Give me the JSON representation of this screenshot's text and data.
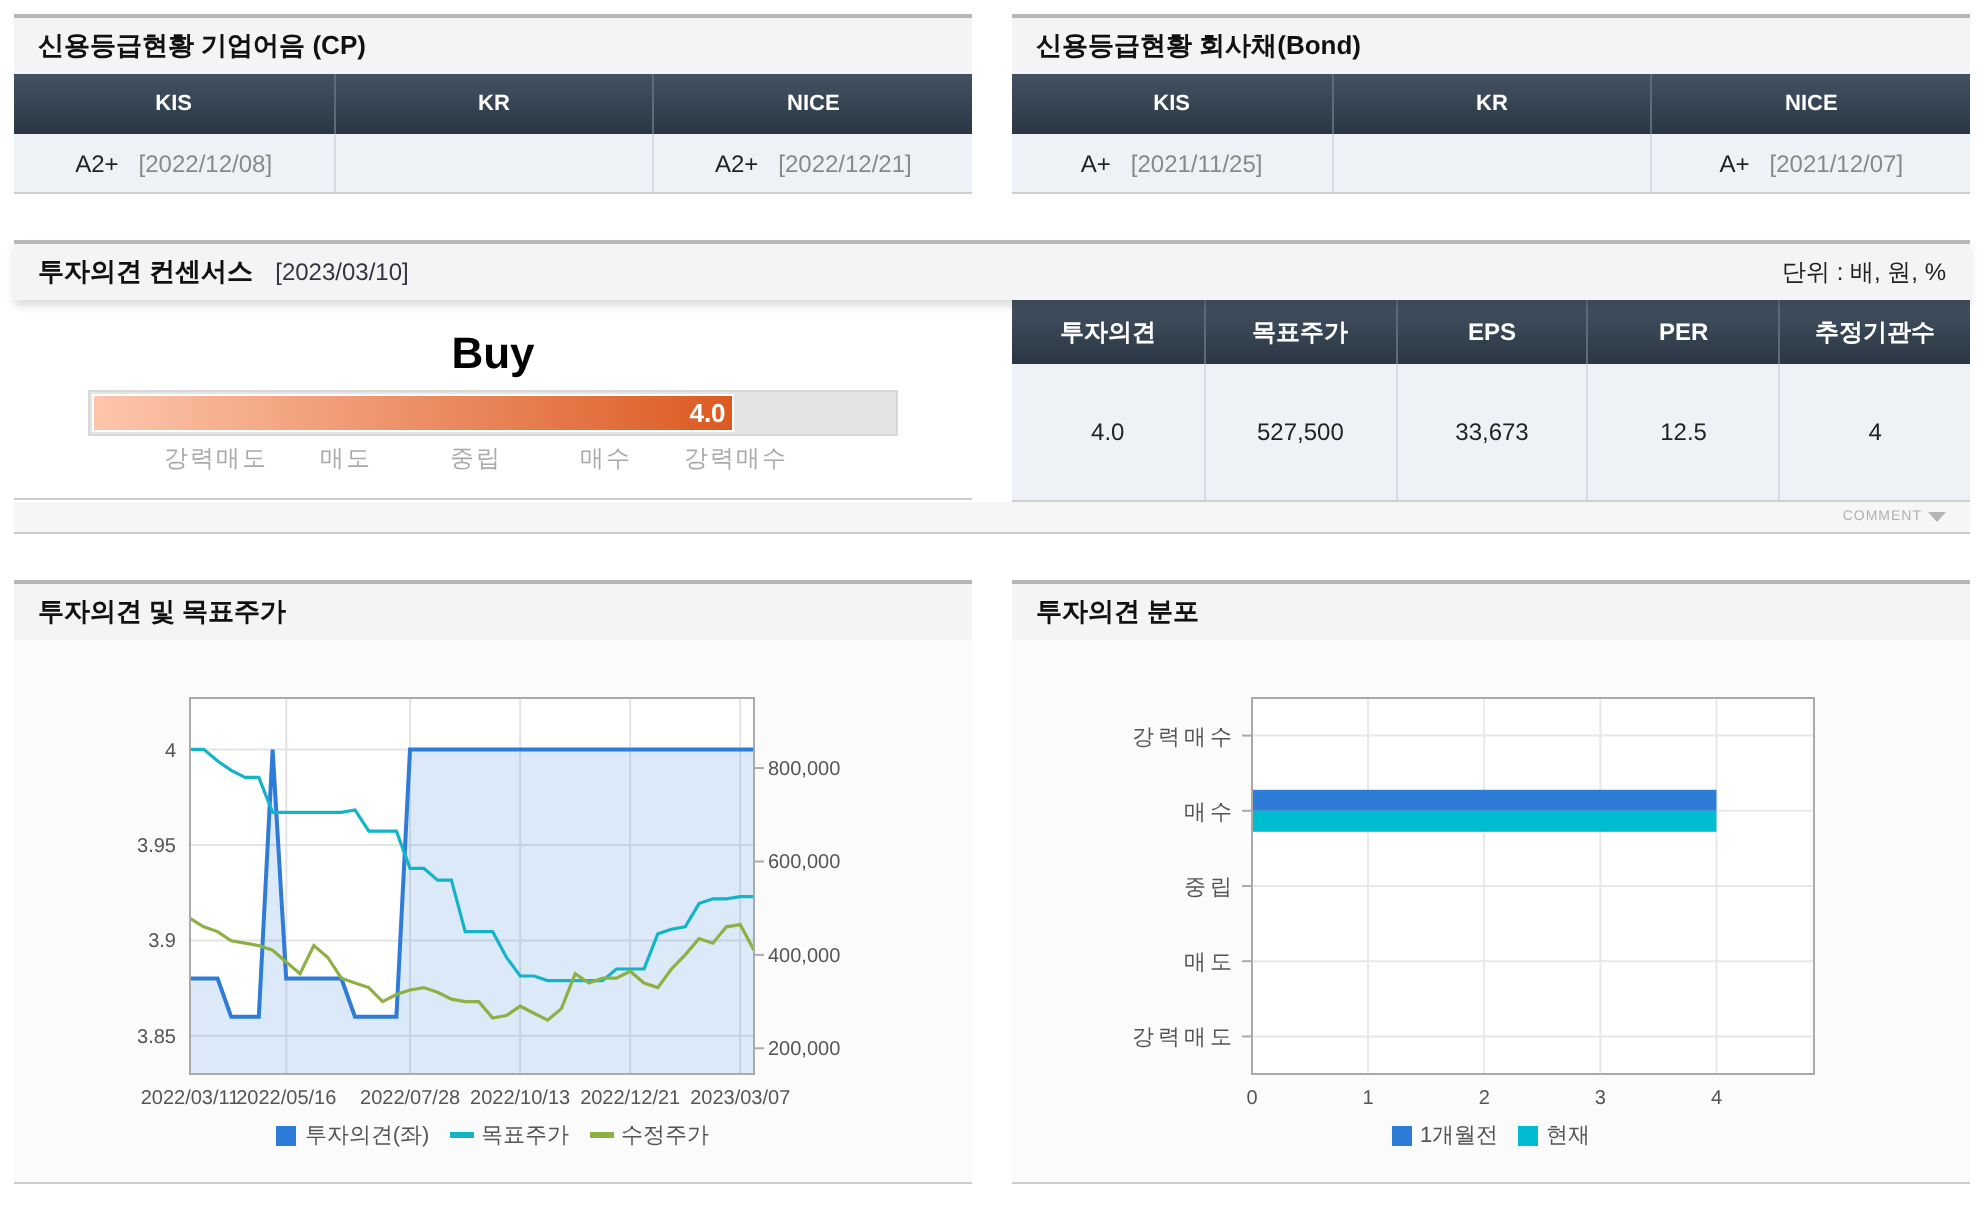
{
  "credit_ratings": [
    {
      "title": "신용등급현황 기업어음 (CP)",
      "columns": [
        "KIS",
        "KR",
        "NICE"
      ],
      "cells": [
        {
          "grade": "A2+",
          "date": "[2022/12/08]"
        },
        null,
        {
          "grade": "A2+",
          "date": "[2022/12/21]"
        }
      ]
    },
    {
      "title": "신용등급현황 회사채(Bond)",
      "columns": [
        "KIS",
        "KR",
        "NICE"
      ],
      "cells": [
        {
          "grade": "A+",
          "date": "[2021/11/25]"
        },
        null,
        {
          "grade": "A+",
          "date": "[2021/12/07]"
        }
      ]
    }
  ],
  "consensus": {
    "title": "투자의견 컨센서스",
    "date": "[2023/03/10]",
    "unit": "단위 : 배, 원, %",
    "gauge": {
      "label": "Buy",
      "value": "4.0",
      "level": 0.8,
      "scale": [
        "강력매도",
        "매도",
        "중립",
        "매수",
        "강력매수"
      ]
    },
    "table": {
      "columns": [
        "투자의견",
        "목표주가",
        "EPS",
        "PER",
        "추정기관수"
      ],
      "row": [
        "4.0",
        "527,500",
        "33,673",
        "12.5",
        "4"
      ]
    },
    "comment": "COMMENT"
  },
  "charts": [
    {
      "title": "투자의견 및 목표주가",
      "chart_data": {
        "type": "line",
        "grid": true,
        "legend": "bottom",
        "categories": [
          "2022/03/11",
          null,
          null,
          null,
          null,
          null,
          null,
          "2022/05/16",
          null,
          null,
          null,
          null,
          null,
          null,
          null,
          null,
          "2022/07/28",
          null,
          null,
          null,
          null,
          null,
          null,
          null,
          "2022/10/13",
          null,
          null,
          null,
          null,
          null,
          null,
          null,
          "2022/12/21",
          null,
          null,
          null,
          null,
          null,
          null,
          null,
          "2023/03/07",
          null
        ],
        "ylim": [
          3.83,
          4.027
        ],
        "yticks": [
          3.85,
          3.9,
          3.95,
          4
        ],
        "y2lim": [
          145000,
          950000
        ],
        "y2ticks": [
          {
            "value": 200000,
            "label": "200,000"
          },
          {
            "value": 400000,
            "label": "400,000"
          },
          {
            "value": 600000,
            "label": "600,000"
          },
          {
            "value": 800000,
            "label": "800,000"
          }
        ],
        "series": [
          {
            "name": "투자의견(좌)",
            "color": "#2e7bd8",
            "type": "area",
            "values": [
              3.88,
              3.88,
              3.88,
              3.86,
              3.86,
              3.86,
              4,
              3.88,
              3.88,
              3.88,
              3.88,
              3.88,
              3.86,
              3.86,
              3.86,
              3.86,
              4,
              4,
              4,
              4,
              4,
              4,
              4,
              4,
              4,
              4,
              4,
              4,
              4,
              4,
              4,
              4,
              4,
              4,
              4,
              4,
              4,
              4,
              4,
              4,
              4,
              4
            ]
          },
          {
            "name": "목표주가",
            "color": "#14b4c8",
            "axis": "y2",
            "values": [
              840000,
              840000,
              815000,
              795000,
              780000,
              780000,
              705000,
              705000,
              705000,
              705000,
              705000,
              705000,
              710000,
              665000,
              665000,
              665000,
              585000,
              585000,
              560000,
              560000,
              450000,
              450000,
              450000,
              395000,
              355000,
              355000,
              345000,
              345000,
              345000,
              345000,
              345000,
              370000,
              370000,
              370000,
              445000,
              455000,
              460000,
              510000,
              520000,
              520000,
              525000,
              525000
            ]
          },
          {
            "name": "수정주가",
            "color": "#8db043",
            "axis": "y2",
            "values": [
              478000,
              460000,
              450000,
              430000,
              425000,
              420000,
              410000,
              385000,
              360000,
              420000,
              395000,
              350000,
              340000,
              330000,
              300000,
              315000,
              325000,
              330000,
              320000,
              305000,
              300000,
              300000,
              265000,
              270000,
              290000,
              275000,
              260000,
              285000,
              360000,
              340000,
              350000,
              350000,
              365000,
              340000,
              330000,
              370000,
              400000,
              435000,
              425000,
              460000,
              465000,
              410000
            ]
          }
        ]
      }
    },
    {
      "title": "투자의견 분포",
      "chart_data": {
        "type": "bar",
        "orientation": "horizontal",
        "grid": true,
        "legend": "bottom",
        "categories": [
          "강력매수",
          "매수",
          "중립",
          "매도",
          "강력매도"
        ],
        "xlim": [
          0,
          4.84
        ],
        "xticks": [
          0,
          1,
          2,
          3,
          4
        ],
        "series": [
          {
            "name": "1개월전",
            "color": "#2e7bd8",
            "values": [
              0,
              4,
              0,
              0,
              0
            ]
          },
          {
            "name": "현재",
            "color": "#00bcd0",
            "values": [
              0,
              4,
              0,
              0,
              0
            ]
          }
        ]
      }
    }
  ]
}
